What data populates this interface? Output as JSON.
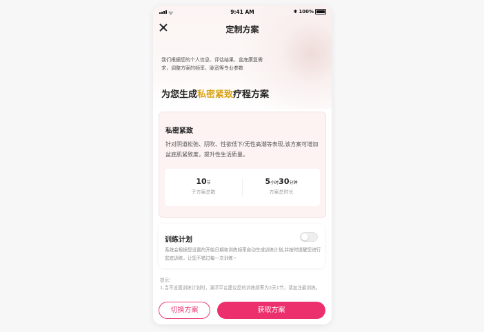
{
  "status_bar": {
    "time": "9:41 AM",
    "battery": "100%"
  },
  "nav": {
    "title": "定制方案"
  },
  "intro": "我们根据您的个人信息、评估结果、盆底康复需求，调整方案的频率、脉宽等专业参数",
  "headline": {
    "prefix": "为您生成",
    "highlight": "私密紧致",
    "suffix": "疗程方案"
  },
  "plan": {
    "name": "私密紧致",
    "description": "针对阴道松弛、阴吹、性欲低下/无性高潮等表现,该方案可增加盆底肌紧致度，提升性生活质量。",
    "stats": [
      {
        "value": "10",
        "unit": "节",
        "label": "子方案总数"
      },
      {
        "value_hours": "5",
        "unit_hours": "小时",
        "value_minutes": "30",
        "unit_minutes": "分钟",
        "label": "方案总时长"
      }
    ]
  },
  "training": {
    "title": "训练计划",
    "enabled": false,
    "description": "系统会根据您设置的开始日期和训练频率自动生成训练计划,并按时提醒您进行盆底训练，让您不错过每一次训练~"
  },
  "tips": {
    "label": "提示：",
    "text": "1.当不设置训练计划时，澜渟平台建议您的训练频率为2天1节，请加注最训练。"
  },
  "buttons": {
    "switch": "切换方案",
    "get": "获取方案"
  },
  "colors": {
    "accent": "#ec2f6d",
    "highlight": "#d9a318"
  }
}
